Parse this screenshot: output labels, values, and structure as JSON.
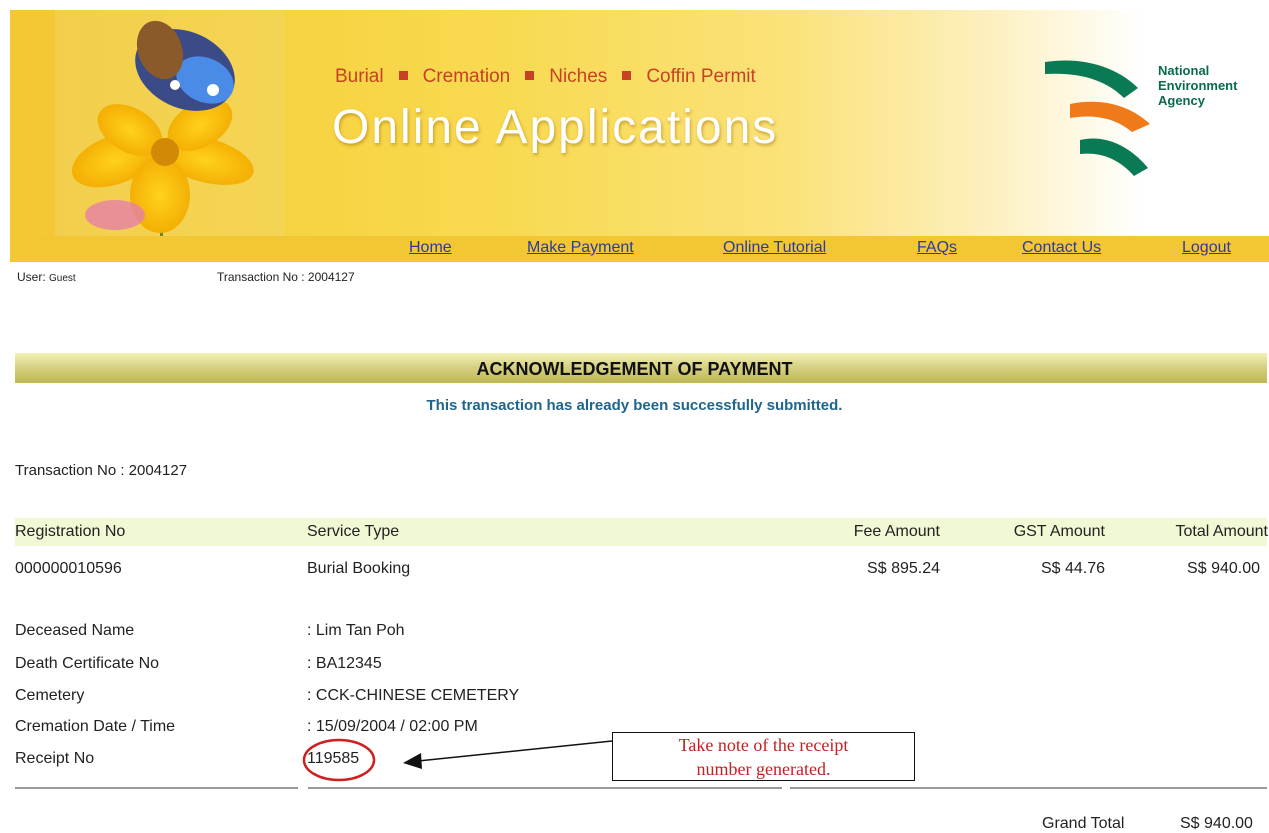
{
  "header": {
    "service_links": [
      "Burial",
      "Cremation",
      "Niches",
      "Coffin Permit"
    ],
    "title": "Online Applications",
    "agency_line1": "National",
    "agency_line2": "Environment",
    "agency_line3": "Agency"
  },
  "nav": {
    "home": "Home",
    "make_payment": "Make Payment",
    "online_tutorial": "Online Tutorial",
    "faqs": "FAQs",
    "contact_us": "Contact Us",
    "logout": "Logout"
  },
  "session": {
    "user_label": "User:",
    "user_value": "Guest",
    "txn_label": "Transaction No : 2004127"
  },
  "page": {
    "title": "ACKNOWLEDGEMENT OF PAYMENT",
    "message": "This transaction has already been successfully submitted.",
    "transaction": "Transaction No : 2004127"
  },
  "table": {
    "headers": [
      "Registration No",
      "Service Type",
      "Fee Amount",
      "GST Amount",
      "Total Amount"
    ],
    "row": [
      "000000010596",
      "Burial Booking",
      "S$ 895.24",
      "S$ 44.76",
      "S$ 940.00"
    ]
  },
  "details": [
    {
      "label": "Deceased Name",
      "value": ": Lim Tan Poh"
    },
    {
      "label": "Death Certificate No",
      "value": ": BA12345"
    },
    {
      "label": "Cemetery",
      "value": ": CCK-CHINESE CEMETERY"
    },
    {
      "label": "Cremation Date / Time",
      "value": ": 15/09/2004 / 02:00 PM"
    },
    {
      "label": "Receipt No",
      "value": "119585"
    }
  ],
  "callout": {
    "line1": "Take note of the receipt",
    "line2": "number generated."
  },
  "total": {
    "label": "Grand Total",
    "value": "S$ 940.00"
  },
  "colors": {
    "banner": "#f3c633",
    "nav_link": "#2a3c9e",
    "service_link": "#c64222",
    "message": "#20658c",
    "callout_text": "#c22222",
    "receipt_circle": "#d01f1f"
  }
}
